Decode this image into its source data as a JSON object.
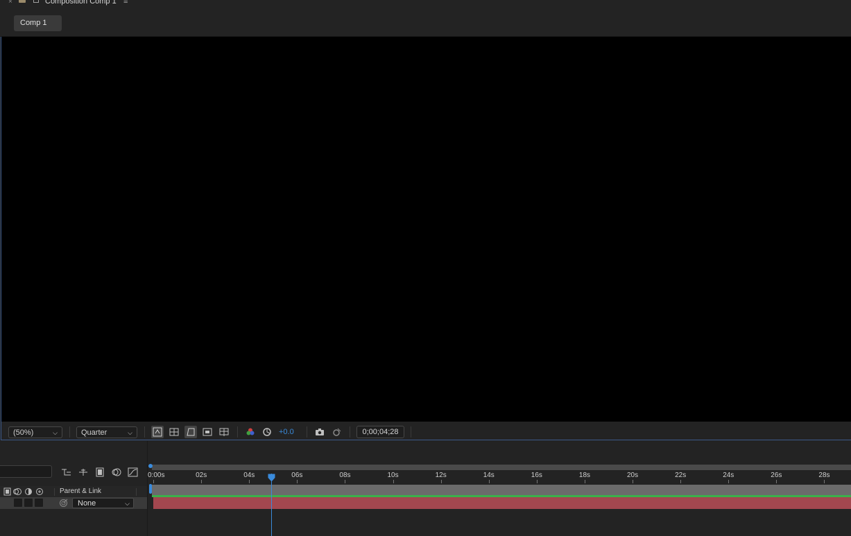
{
  "panel": {
    "title": "Composition Comp 1",
    "close": "×",
    "menu": "≡"
  },
  "tab": {
    "label": "Comp 1"
  },
  "viewer_bar": {
    "zoom": "(50%)",
    "resolution": "Quarter",
    "exposure": "+0.0",
    "timecode": "0;00;04;28",
    "icons": [
      "snapshot-toggle-icon",
      "transparency-grid-icon",
      "mask-visibility-icon",
      "region-of-interest-icon",
      "guides-icon",
      "color-channels-icon",
      "reset-exposure-icon",
      "camera-snapshot-icon",
      "show-snapshot-icon"
    ]
  },
  "timeline": {
    "column_header": "Parent & Link",
    "layer": {
      "parent": "None"
    },
    "ruler_labels": [
      "0:00s",
      "02s",
      "04s",
      "06s",
      "08s",
      "10s",
      "12s",
      "14s",
      "16s",
      "18s",
      "20s",
      "22s",
      "24s",
      "26s",
      "28s"
    ],
    "duration_seconds": 30,
    "current_time_seconds": 4.93
  },
  "colors": {
    "accent": "#3a8bdc",
    "layer_bar": "#a3474f",
    "green_bar": "#3bb04b"
  }
}
